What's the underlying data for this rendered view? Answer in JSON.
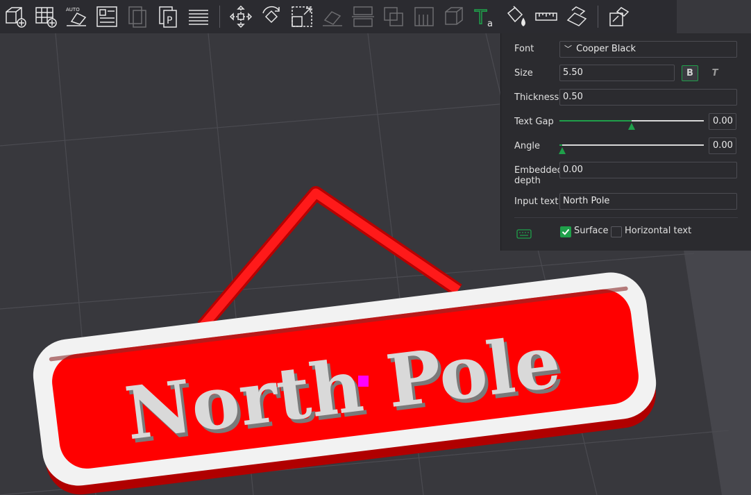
{
  "toolbar": {
    "buttons": [
      {
        "name": "add-object-icon",
        "enabled": true
      },
      {
        "name": "add-plate-icon",
        "enabled": true
      },
      {
        "name": "auto-orient-icon",
        "enabled": true
      },
      {
        "name": "arrange-icon",
        "enabled": true
      },
      {
        "name": "copy-icon",
        "enabled": false
      },
      {
        "name": "paste-icon",
        "enabled": true
      },
      {
        "name": "layers-list-icon",
        "enabled": true
      },
      {
        "name": "move-icon",
        "enabled": true
      },
      {
        "name": "rotate-icon",
        "enabled": true
      },
      {
        "name": "scale-icon",
        "enabled": true
      },
      {
        "name": "lay-on-face-icon",
        "enabled": false
      },
      {
        "name": "cut-icon",
        "enabled": false
      },
      {
        "name": "boolean-icon",
        "enabled": false
      },
      {
        "name": "support-paint-icon",
        "enabled": false
      },
      {
        "name": "seam-paint-icon",
        "enabled": false
      },
      {
        "name": "text-tool-icon",
        "enabled": true
      },
      {
        "name": "color-paint-icon",
        "enabled": true
      },
      {
        "name": "measure-icon",
        "enabled": true
      },
      {
        "name": "assembly-icon",
        "enabled": true
      },
      {
        "name": "split-icon",
        "enabled": true
      }
    ],
    "text_icon_letter": "T",
    "text_icon_sub": "a",
    "auto_badge": "AUTO"
  },
  "text_panel": {
    "font_label": "Font",
    "font_value": "Cooper Black",
    "font_chevron": "﹀",
    "size_label": "Size",
    "size_value": "5.50",
    "bold_label": "B",
    "italic_label": "T",
    "thickness_label": "Thickness",
    "thickness_value": "0.50",
    "text_gap_label": "Text Gap",
    "text_gap_value": "0.00",
    "text_gap_fraction": 0.5,
    "angle_label": "Angle",
    "angle_value": "0.00",
    "angle_fraction": 0.02,
    "embedded_label_1": "Embedded",
    "embedded_label_2": "depth",
    "embedded_value": "0.00",
    "input_text_label": "Input text",
    "input_text_value": "North Pole",
    "surface_label": "Surface",
    "surface_checked": true,
    "horizontal_label": "Horizontal text",
    "horizontal_checked": false
  },
  "scene": {
    "sign_text": "North Pole",
    "colors": {
      "background": "#38383d",
      "grid": "#4a4a50",
      "sign_red": "#ff0000",
      "sign_white": "#f2f2f2",
      "text_gray": "#d9d9d9",
      "marker": "#ff00ff",
      "accent": "#1fa04a"
    }
  }
}
